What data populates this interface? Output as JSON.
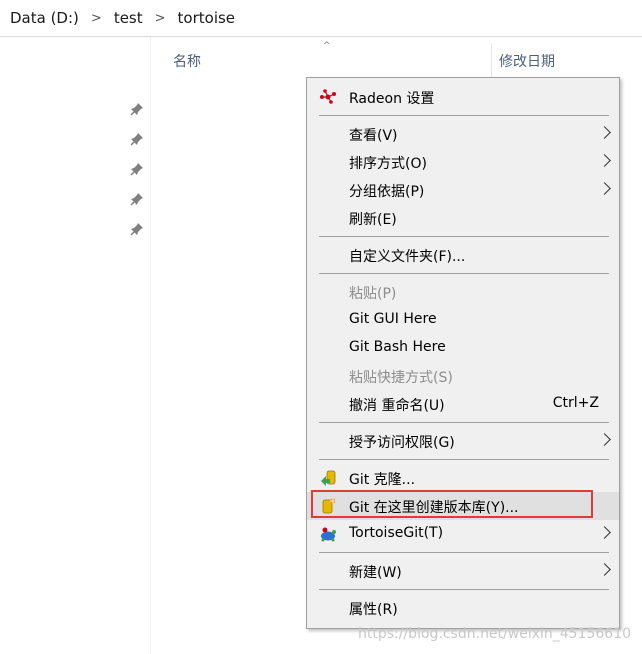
{
  "breadcrumb": [
    {
      "label": "Data (D:)"
    },
    {
      "label": "test"
    },
    {
      "label": "tortoise"
    }
  ],
  "breadcrumb_separator": ">",
  "columns": {
    "name": "名称",
    "date_modified": "修改日期",
    "sort_glyph": "^"
  },
  "nav": {
    "pin_glyph": "📌",
    "pinned_count": 5
  },
  "menu": {
    "radeon": "Radeon 设置",
    "view": "查看(V)",
    "sort_by": "排序方式(O)",
    "group_by": "分组依据(P)",
    "refresh": "刷新(E)",
    "customize_folder": "自定义文件夹(F)...",
    "paste": "粘贴(P)",
    "git_gui": "Git GUI Here",
    "git_bash": "Git Bash Here",
    "paste_shortcut": "粘贴快捷方式(S)",
    "undo_rename": "撤消 重命名(U)",
    "undo_shortcut": "Ctrl+Z",
    "give_access": "授予访问权限(G)",
    "git_clone": "Git 克隆...",
    "git_create_repo": "Git 在这里创建版本库(Y)...",
    "tortoisegit": "TortoiseGit(T)",
    "new": "新建(W)",
    "properties": "属性(R)"
  },
  "colors": {
    "highlight_border": "#e03a3a",
    "menu_bg": "#f0f0f0",
    "disabled_text": "#8d8d8d"
  },
  "watermark": "https://blog.csdn.net/weixin_45156610"
}
